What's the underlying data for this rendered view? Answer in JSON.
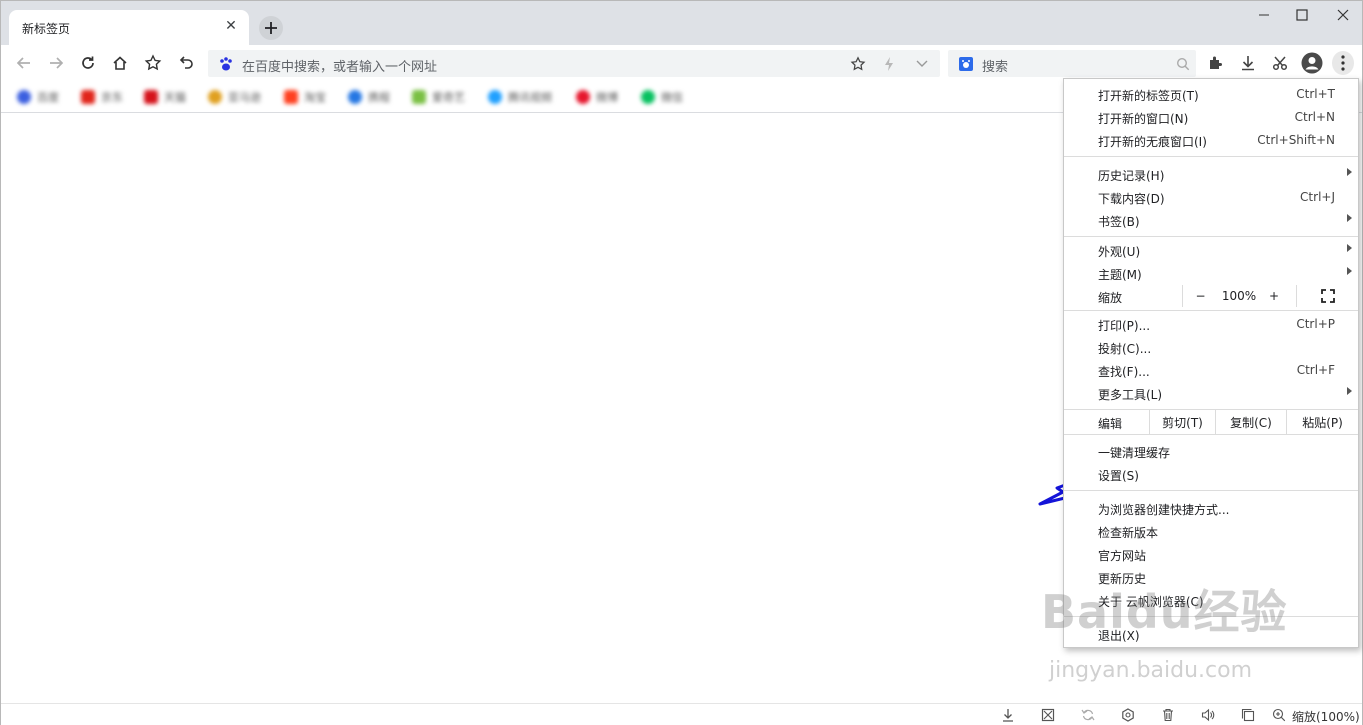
{
  "tab": {
    "title": "新标签页",
    "close": "✕"
  },
  "toolbar": {
    "address_placeholder": "在百度中搜索，或者输入一个网址",
    "search_placeholder": "搜索"
  },
  "bookmarks": [
    {
      "label": "百度",
      "color": "#3b5fe0"
    },
    {
      "label": "京东",
      "color": "#e1251b"
    },
    {
      "label": "天猫",
      "color": "#d5121b"
    },
    {
      "label": "亚马逊",
      "color": "#e0a020"
    },
    {
      "label": "淘宝",
      "color": "#ff4020"
    },
    {
      "label": "携程",
      "color": "#2577e3"
    },
    {
      "label": "爱奇艺",
      "color": "#7ac043"
    },
    {
      "label": "腾讯视频",
      "color": "#20a0ff"
    },
    {
      "label": "微博",
      "color": "#e6162d"
    },
    {
      "label": "微信",
      "color": "#07c160"
    }
  ],
  "menu": {
    "new_tab": {
      "label": "打开新的标签页(T)",
      "shortcut": "Ctrl+T"
    },
    "new_window": {
      "label": "打开新的窗口(N)",
      "shortcut": "Ctrl+N"
    },
    "incognito": {
      "label": "打开新的无痕窗口(I)",
      "shortcut": "Ctrl+Shift+N"
    },
    "history": {
      "label": "历史记录(H)"
    },
    "downloads": {
      "label": "下载内容(D)",
      "shortcut": "Ctrl+J"
    },
    "bookmarks": {
      "label": "书签(B)"
    },
    "appearance": {
      "label": "外观(U)"
    },
    "theme": {
      "label": "主题(M)"
    },
    "zoom": {
      "label": "缩放",
      "minus": "−",
      "value": "100%",
      "plus": "+"
    },
    "print": {
      "label": "打印(P)...",
      "shortcut": "Ctrl+P"
    },
    "cast": {
      "label": "投射(C)..."
    },
    "find": {
      "label": "查找(F)...",
      "shortcut": "Ctrl+F"
    },
    "more_tools": {
      "label": "更多工具(L)"
    },
    "edit": {
      "label": "编辑",
      "cut": "剪切(T)",
      "copy": "复制(C)",
      "paste": "粘贴(P)"
    },
    "clear_cache": {
      "label": "一键清理缓存"
    },
    "settings": {
      "label": "设置(S)"
    },
    "shortcut": {
      "label": "为浏览器创建快捷方式..."
    },
    "check_update": {
      "label": "检查新版本"
    },
    "official_site": {
      "label": "官方网站"
    },
    "update_history": {
      "label": "更新历史"
    },
    "about": {
      "label": "关于 云帆浏览器(C)"
    },
    "exit": {
      "label": "退出(X)"
    }
  },
  "statusbar": {
    "zoom": "缩放(100%)"
  },
  "watermark": {
    "main": "Baidu经验",
    "sub": "jingyan.baidu.com"
  },
  "colors": {
    "accent_arrow": "#1414d8",
    "tabstrip": "#dee1e6"
  }
}
